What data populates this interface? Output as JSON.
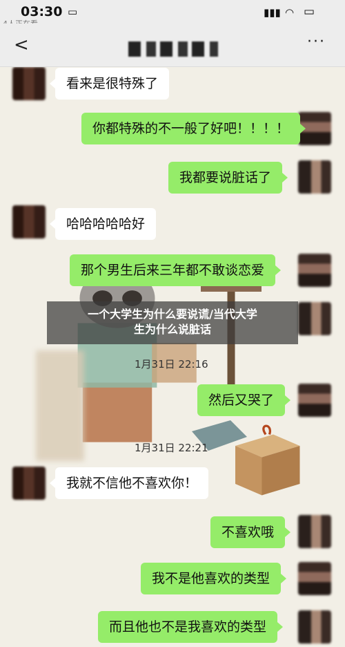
{
  "status_bar": {
    "time": "03:30",
    "watchers": "4人正在看"
  },
  "nav": {
    "back_label": "<",
    "more_label": "···"
  },
  "messages": [
    {
      "side": "left",
      "text": "看来是很特殊了"
    },
    {
      "side": "right",
      "text": "你都特殊的不一般了好吧！！！！"
    },
    {
      "side": "right",
      "text": "我都要说脏话了"
    },
    {
      "side": "left",
      "text": "哈哈哈哈哈好"
    },
    {
      "side": "right",
      "text": "那个男生后来三年都不敢谈恋爱"
    },
    {
      "side": "right",
      "text": "然后又哭了"
    },
    {
      "side": "left",
      "text": "我就不信他不喜欢你！"
    },
    {
      "side": "right",
      "text": "不喜欢哦"
    },
    {
      "side": "right",
      "text": "我不是他喜欢的类型"
    },
    {
      "side": "right",
      "text": "而且他也不是我喜欢的类型"
    }
  ],
  "timestamps": [
    "1月31日 22:16",
    "1月31日 22:21"
  ],
  "headline": {
    "line1": "一个大学生为什么要说谎/当代大学",
    "line2": "生为什么说脏话"
  },
  "colors": {
    "sent_bubble": "#95ec69",
    "received_bubble": "#ffffff",
    "nav_background": "#ededed"
  },
  "icons": {
    "back": "chevron-left-icon",
    "more": "more-dots-icon",
    "signal": "signal-icon",
    "wifi": "wifi-icon",
    "battery": "battery-icon"
  }
}
